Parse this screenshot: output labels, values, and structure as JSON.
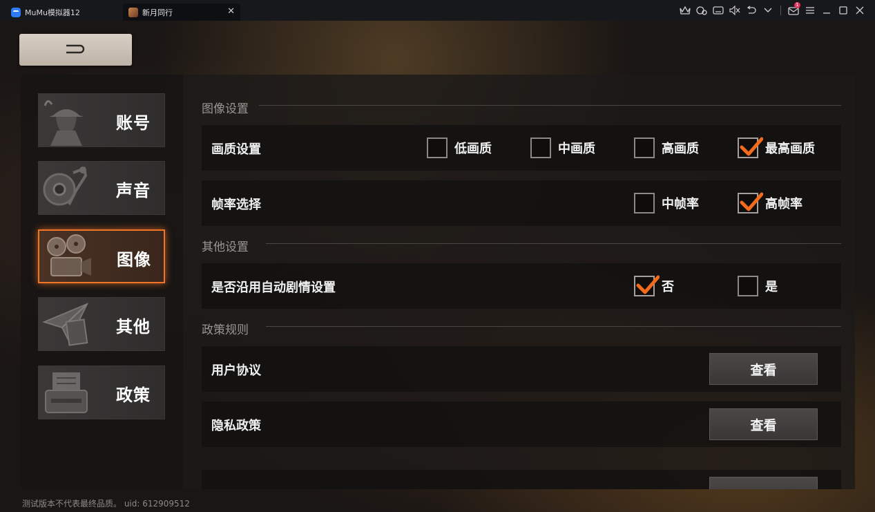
{
  "titlebar": {
    "app_tab_label": "MuMu模拟器12",
    "game_tab_label": "新月同行",
    "close_tab_glyph": "✕",
    "mail_badge_count": "1"
  },
  "nav": {
    "items": [
      {
        "label": "账号",
        "icon": "detective-icon",
        "active": false
      },
      {
        "label": "声音",
        "icon": "record-player-icon",
        "active": false
      },
      {
        "label": "图像",
        "icon": "film-projector-icon",
        "active": true
      },
      {
        "label": "其他",
        "icon": "paper-plane-icon",
        "active": false
      },
      {
        "label": "政策",
        "icon": "typewriter-icon",
        "active": false
      }
    ]
  },
  "sections": {
    "image": "图像设置",
    "other": "其他设置",
    "policy": "政策规则"
  },
  "rows": {
    "quality": {
      "label": "画质设置",
      "options": [
        {
          "label": "低画质",
          "checked": false
        },
        {
          "label": "中画质",
          "checked": false
        },
        {
          "label": "高画质",
          "checked": false
        },
        {
          "label": "最高画质",
          "checked": true
        }
      ]
    },
    "framerate": {
      "label": "帧率选择",
      "options": [
        {
          "label": "中帧率",
          "checked": false
        },
        {
          "label": "高帧率",
          "checked": true
        }
      ]
    },
    "auto_story": {
      "label": "是否沿用自动剧情设置",
      "options": [
        {
          "label": "否",
          "checked": true
        },
        {
          "label": "是",
          "checked": false
        }
      ]
    },
    "user_agreement": {
      "label": "用户协议",
      "button": "查看"
    },
    "privacy": {
      "label": "隐私政策",
      "button": "查看"
    }
  },
  "footer": "测试版本不代表最终品质。 uid: 612909512",
  "colors": {
    "accent": "#f27527",
    "check": "#f26a1b"
  }
}
